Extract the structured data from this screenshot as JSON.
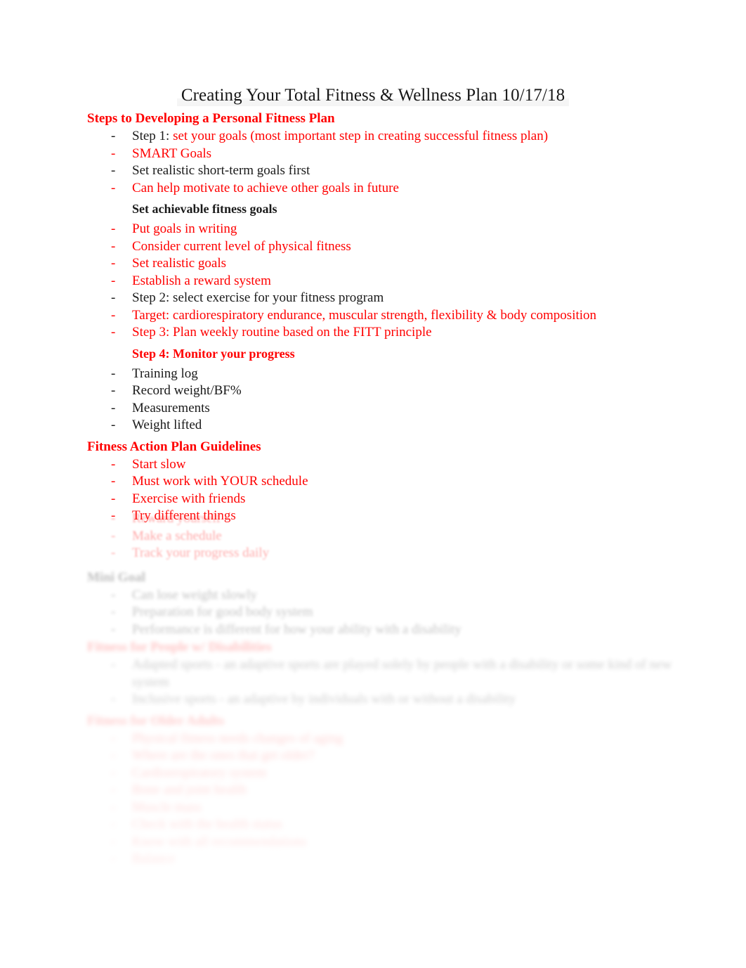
{
  "document": {
    "title": "Creating Your Total Fitness & Wellness Plan 10/17/18",
    "colors": {
      "accent_red": "#FF0000",
      "body_black": "#1a1a1a",
      "page_background": "#ffffff"
    }
  },
  "sections": [
    {
      "heading": "Steps to Developing a Personal Fitness Plan",
      "heading_color": "red",
      "items": [
        {
          "lead": "Step 1: ",
          "rest": "set your goals (most important step in creating successful fitness plan)",
          "style": "mixed"
        },
        {
          "text": "SMART Goals",
          "style": "red"
        },
        {
          "text": "Set realistic short-term goals first",
          "style": "black"
        },
        {
          "text": "Can help motivate to achieve other goals in future",
          "style": "red"
        }
      ]
    },
    {
      "subheading": "Set achievable fitness goals",
      "subheading_color": "black",
      "items": [
        {
          "text": "Put goals in writing",
          "style": "red"
        },
        {
          "text": "Consider current level of physical fitness",
          "style": "red"
        },
        {
          "text": "Set realistic goals",
          "style": "red"
        },
        {
          "text": "Establish a reward system",
          "style": "red"
        },
        {
          "text": "Step 2: select exercise for your fitness program",
          "style": "black"
        },
        {
          "text": "Target: cardiorespiratory endurance, muscular strength, flexibility & body composition",
          "style": "red"
        },
        {
          "text": "Step 3: Plan weekly routine based on the FITT principle",
          "style": "red"
        }
      ]
    },
    {
      "subheading": "Step 4: Monitor your progress",
      "subheading_color": "red",
      "items": [
        {
          "text": "Training log",
          "style": "black"
        },
        {
          "text": "Record weight/BF%",
          "style": "black"
        },
        {
          "text": "Measurements",
          "style": "black"
        },
        {
          "text": "Weight lifted",
          "style": "black"
        }
      ]
    },
    {
      "heading": "Fitness Action Plan Guidelines",
      "heading_color": "red",
      "items": [
        {
          "text": "Start slow",
          "style": "red"
        },
        {
          "text": "Must work with YOUR schedule",
          "style": "red"
        },
        {
          "text": "Exercise with friends",
          "style": "red"
        },
        {
          "text": "Try different things",
          "style": "red"
        }
      ]
    }
  ],
  "illegible_lower_content": {
    "note": "Lower portion of the page is progressively blurred and faded out; text shapes are visible but not readable.",
    "blocks": [
      {
        "kind": "bullets",
        "style": "red",
        "blur_level": 1,
        "lines": [
          "Reward yourself",
          "Make a schedule",
          "Track your progress     daily"
        ]
      },
      {
        "kind": "heading",
        "style": "black",
        "blur_level": 2,
        "text": "Mini Goal"
      },
      {
        "kind": "bullets",
        "style": "black",
        "blur_level": 2,
        "lines": [
          "Can lose weight slowly",
          "Preparation for good body system",
          "Performance is different for how your ability with a disability"
        ]
      },
      {
        "kind": "heading",
        "style": "red",
        "blur_level": 3,
        "text": "Fitness for People w/ Disabilities"
      },
      {
        "kind": "bullets",
        "style": "black",
        "blur_level": 3,
        "lines": [
          "Adapted sports - an adaptive sports are played solely by people with a disability or some kind of new system",
          "Inclusive sports - an adaptive by individuals with or without a disability"
        ]
      },
      {
        "kind": "heading",
        "style": "red",
        "blur_level": 4,
        "text": "Fitness for Older Adults"
      },
      {
        "kind": "bullets",
        "style": "red",
        "blur_level": 5,
        "lines": [
          "Physical fitness needs changes of aging",
          "Where are the ones that get older?",
          "Cardiorespiratory system",
          "Bone and joint health",
          "Muscle mass",
          "Check with the health status",
          "Know with all recommendations",
          "Balance"
        ]
      }
    ]
  }
}
